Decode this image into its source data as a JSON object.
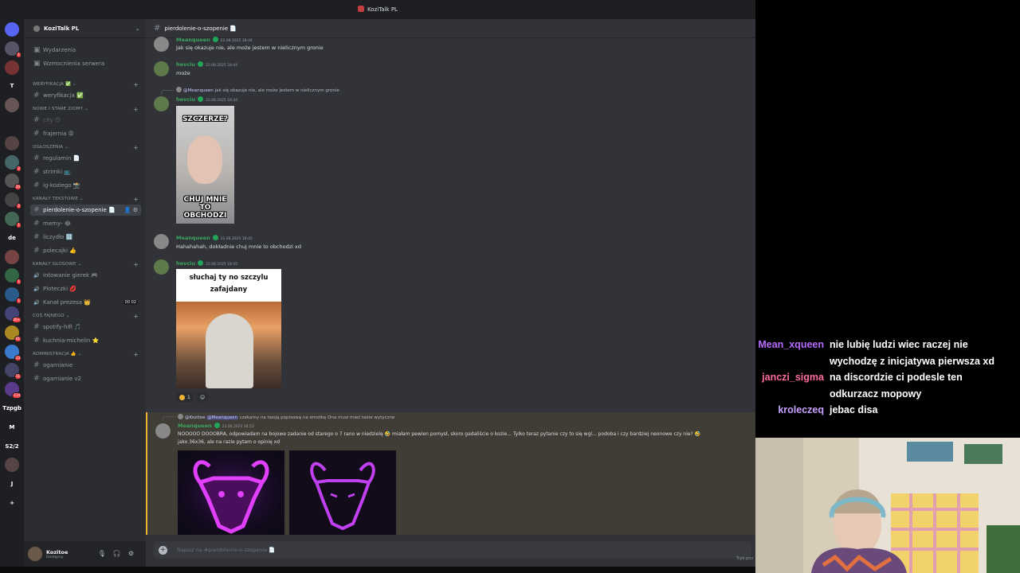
{
  "window": {
    "title": "KoziTalk PL"
  },
  "guild": {
    "name": "KoziTalk PL"
  },
  "rail": {
    "servers": [
      {
        "label": "",
        "badge": ""
      },
      {
        "label": "",
        "badge": "1"
      },
      {
        "label": "",
        "badge": ""
      },
      {
        "label": "T",
        "badge": ""
      },
      {
        "label": "",
        "badge": ""
      },
      {
        "label": "",
        "badge": ""
      },
      {
        "label": "",
        "badge": ""
      },
      {
        "label": "",
        "badge": "2"
      },
      {
        "label": "",
        "badge": "34"
      },
      {
        "label": "",
        "badge": "2"
      },
      {
        "label": "",
        "badge": "1"
      },
      {
        "label": "de",
        "badge": ""
      },
      {
        "label": "",
        "badge": ""
      },
      {
        "label": "",
        "badge": "1"
      },
      {
        "label": "",
        "badge": "1"
      },
      {
        "label": "",
        "badge": "35+"
      },
      {
        "label": "",
        "badge": "61"
      },
      {
        "label": "",
        "badge": "13"
      },
      {
        "label": "",
        "badge": "11"
      },
      {
        "label": "",
        "badge": "114"
      },
      {
        "label": "Tzpgb",
        "badge": ""
      },
      {
        "label": "M",
        "badge": ""
      },
      {
        "label": "S2/2",
        "badge": ""
      },
      {
        "label": "",
        "badge": ""
      },
      {
        "label": "J",
        "badge": ""
      },
      {
        "label": "+",
        "badge": ""
      }
    ]
  },
  "sidebar": {
    "top": [
      {
        "icon": "calendar-icon",
        "label": "Wydarzenia"
      },
      {
        "icon": "boost-icon",
        "label": "Wzmocnienia serwera"
      }
    ],
    "categories": [
      {
        "label": "WERYFIKACJA ✅",
        "channels": [
          {
            "label": "weryfikacja ✅"
          }
        ]
      },
      {
        "label": "NOWE I STARE ZIOMY",
        "channels": [
          {
            "label": "city 😊"
          },
          {
            "label": "frajernia 😡"
          }
        ]
      },
      {
        "label": "OGŁOSZENIA",
        "channels": [
          {
            "label": "regulamin 📄"
          },
          {
            "label": "strimki 📺"
          },
          {
            "label": "ig-koziego 📸"
          }
        ]
      },
      {
        "label": "KANAŁY TEKSTOWE",
        "channels": [
          {
            "label": "pierdolenie-o-szopenie 📄"
          },
          {
            "label": "memy- 😂"
          },
          {
            "label": "liczydło 🔢"
          },
          {
            "label": "polecajki 👍"
          }
        ]
      },
      {
        "label": "KANAŁY GŁOSOWE",
        "channels": [
          {
            "label": "intowanie gierek 🎮"
          },
          {
            "label": "Ploteczki 💋"
          },
          {
            "label": "Kanał prezesa 👑",
            "counter_a": "00",
            "counter_b": "02"
          }
        ]
      },
      {
        "label": "COŚ FAJNEGO",
        "channels": [
          {
            "label": "spotify-hifi 🎵"
          },
          {
            "label": "kuchnia-michelin ⭐"
          }
        ]
      },
      {
        "label": "ADMINISTRACJA 👍",
        "channels": [
          {
            "label": "ogarnianie"
          },
          {
            "label": "ogarnianie v2"
          }
        ]
      }
    ]
  },
  "user": {
    "name": "Kozitoe",
    "status": "Dostępny"
  },
  "chat": {
    "channel": "pierdolenie-o-szopenie 📄",
    "messages": {
      "m0": {
        "author": "Meanqueen",
        "time": "22.08.2025 18:44",
        "text": "Jak się okazuje nie, ale może jestem w nielicznym gronie"
      },
      "m1": {
        "author": "hevciu",
        "time": "22.08.2025 18:44",
        "text": "może"
      },
      "m2": {
        "reply_author": "@Meanqueen",
        "reply_text": "Jak się okazuje nie, ale może jestem w nielicznym gronie",
        "author": "hevciu",
        "time": "22.08.2025 18:44",
        "meme_top": "SZCZERZE?",
        "meme_bottom": "CHUJ MNIE TO OBCHODZI"
      },
      "m3": {
        "author": "Meanqueen",
        "time": "22.08.2025 18:45",
        "text": "Hahahahah, dokładnie chuj mnie to obchodzi xd"
      },
      "m4": {
        "author": "hevciu",
        "time": "22.08.2025 18:45",
        "meme_caption": "słuchaj ty no szczylu zafajdany",
        "reaction_count": "1"
      },
      "m5": {
        "reply_author": "@Kozitoe",
        "reply_mention": "@Meanqueen",
        "reply_text": "czekamy na twoją popisową na emotkę Ona musi mieć takie wytyczne",
        "author": "Meanqueen",
        "time": "22.08.2025 18:53",
        "text": "NOOOOO DOOOBRA, odpowiadam na bojowe zadanie od starego o 7 rano w niedzielę 🤣 miałam pewien pomysł, skoro gadaliście o kozie... Tylko teraz pytanie czy to się wgl... podoba i czy bardziej neonowe czy nie? 🤣",
        "text2": "jako 36x36, ale na razie pytam o opinię xd"
      }
    },
    "composer_placeholder": "Napisz na #pierdolenie-o-szopenie 📄"
  },
  "stream_chat": [
    {
      "user": "Mean_xqueen",
      "color": "#b86bff",
      "lines": [
        "nie lubię ludzi wiec raczej nie",
        "wychodzę z inicjatywa pierwsza xd"
      ]
    },
    {
      "user": "janczi_sigma",
      "color": "#ff6b9d",
      "lines": [
        "na discordzie ci podesle ten",
        "odkurzacz mopowy"
      ]
    },
    {
      "user": "kroleczeq",
      "color": "#c8a0ff",
      "lines": [
        "jebac disa"
      ]
    }
  ],
  "footer": {
    "tryb": "Tryb pov"
  },
  "colors": {
    "accent": "#5865f2",
    "online": "#23a559",
    "name_green": "#3ba55d"
  }
}
